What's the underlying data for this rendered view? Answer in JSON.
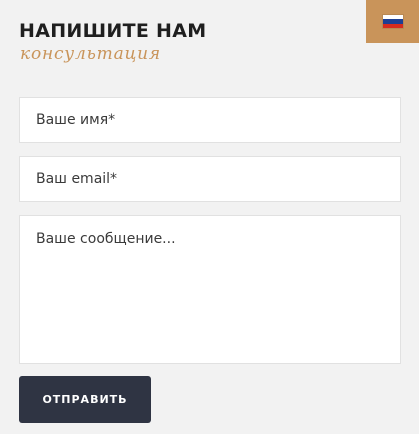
{
  "header": {
    "title": "НАПИШИТЕ НАМ",
    "subtitle": "консультация"
  },
  "language_switch": {
    "flag": "russia-flag-icon",
    "flag_colors": [
      "#ffffff",
      "#1c3f94",
      "#d52b1e"
    ]
  },
  "form": {
    "name_placeholder": "Ваше имя*",
    "email_placeholder": "Ваш email*",
    "message_placeholder": "Ваше сообщение...",
    "submit_label": "ОТПРАВИТЬ"
  },
  "colors": {
    "accent": "#c9945a",
    "button": "#2f3443",
    "background": "#f2f2f2"
  }
}
